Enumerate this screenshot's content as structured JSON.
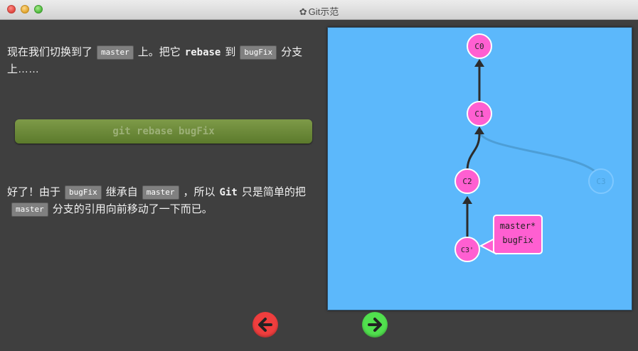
{
  "window": {
    "title": "Git示范",
    "gear_icon": "gear-icon"
  },
  "lesson": {
    "para1": {
      "pre": "现在我们切换到了",
      "code1": "master",
      "mid": "上。把它",
      "kw": "rebase",
      "mid2": "到",
      "code2": "bugFix",
      "post": "分支上……"
    },
    "command": "git rebase bugFix",
    "para2": {
      "pre": "好了！由于",
      "code1": "bugFix",
      "mid": "继承自",
      "code2": "master",
      "mid2": "，所以",
      "kw": "Git",
      "mid3": "只是简单的把",
      "code3": "master",
      "post": "分支的引用向前移动了一下而已。"
    }
  },
  "nav": {
    "back_icon": "arrow-left-icon",
    "forward_icon": "arrow-right-icon",
    "back_color": "#ef3e3e",
    "forward_color": "#51e04e"
  },
  "graph": {
    "commits": [
      {
        "id": "c0",
        "label": "C0"
      },
      {
        "id": "c1",
        "label": "C1"
      },
      {
        "id": "c2",
        "label": "C2"
      },
      {
        "id": "c3",
        "label": "C3",
        "faded": true
      },
      {
        "id": "c3p",
        "label": "C3'"
      }
    ],
    "branch_tag": {
      "line1": "master*",
      "line2": "bugFix"
    },
    "colors": {
      "background": "#5cb8fb",
      "commit": "#ff5fd1",
      "faded_commit": "#5cb8fb",
      "edge": "#2c2c2c",
      "faded_edge": "#4d9ed6"
    }
  }
}
